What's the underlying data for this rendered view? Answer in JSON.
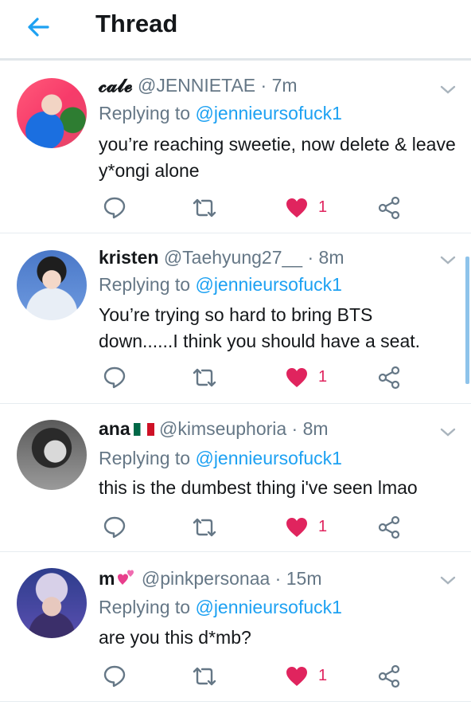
{
  "header": {
    "title": "Thread"
  },
  "tweets": [
    {
      "name": "𝓬𝓪𝓵𝓮",
      "handle": "@JENNIETAE · 7m",
      "replying_label": "Replying to",
      "replying_to": "@jennieursofuck1",
      "text": "you’re reaching sweetie, now delete & leave y*ongi alone",
      "likes": "1"
    },
    {
      "name": "kristen",
      "handle": "@Taehyung27__ · 8m",
      "replying_label": "Replying to",
      "replying_to": "@jennieursofuck1",
      "text": "You’re trying so hard to bring BTS down......I think you should have a seat.",
      "likes": "1"
    },
    {
      "name": "ana",
      "handle": "@kimseuphoria · 8m",
      "replying_label": "Replying to",
      "replying_to": "@jennieursofuck1",
      "text": "this is the dumbest thing i've seen lmao",
      "likes": "1"
    },
    {
      "name": "m",
      "handle": "@pinkpersonaa · 15m",
      "replying_label": "Replying to",
      "replying_to": "@jennieursofuck1",
      "text": "are you this d*mb?",
      "likes": "1"
    }
  ],
  "colors": {
    "accent": "#1da1f2",
    "like": "#e0245e",
    "muted": "#657786"
  },
  "icons": {
    "back": "arrow-left-icon",
    "reply": "reply-icon",
    "retweet": "retweet-icon",
    "like": "heart-icon",
    "share": "share-icon",
    "menu": "chevron-down-icon"
  }
}
